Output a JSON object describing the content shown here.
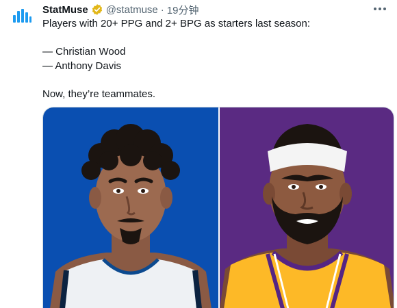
{
  "tweet": {
    "author_name": "StatMuse",
    "handle": "@statmuse",
    "separator": "·",
    "time": "19分钟",
    "lines": [
      "Players with 20+ PPG and 2+ BPG as starters last season:",
      "",
      "— Christian Wood",
      "— Anthony Davis",
      "",
      "Now, they’re teammates."
    ]
  },
  "colors": {
    "left_panel_bg": "#0a4fb1",
    "right_panel_bg": "#5a2a82",
    "lakers_gold": "#fdb927",
    "lakers_purple": "#552583",
    "verified_gold": "#e2b719",
    "statmuse_blue": "#1d9bf0"
  },
  "icons": {
    "avatar": "statmuse-logo-icon",
    "verified": "verified-badge-icon",
    "more": "more-options-icon"
  }
}
